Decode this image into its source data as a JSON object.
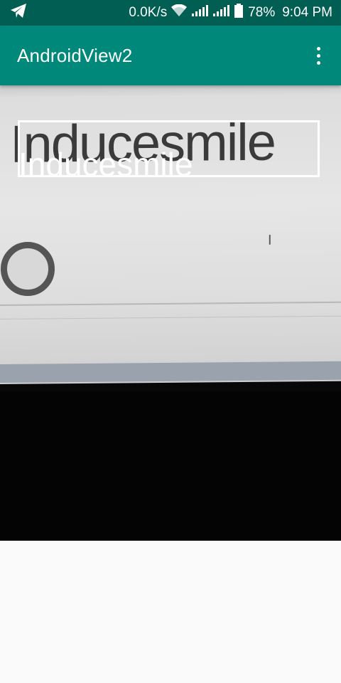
{
  "status_bar": {
    "network_speed": "0.0K/s",
    "battery": "78%",
    "time": "9:04 PM",
    "icons": [
      "telegram-icon",
      "wifi-icon",
      "signal-icon",
      "signal-icon",
      "battery-icon"
    ]
  },
  "app_bar": {
    "title": "AndroidView2",
    "menu_icon": "more-vert-icon",
    "color": "#00897b"
  },
  "preview": {
    "detected_text": "Inducesmile",
    "box_color": "#ffffff"
  }
}
